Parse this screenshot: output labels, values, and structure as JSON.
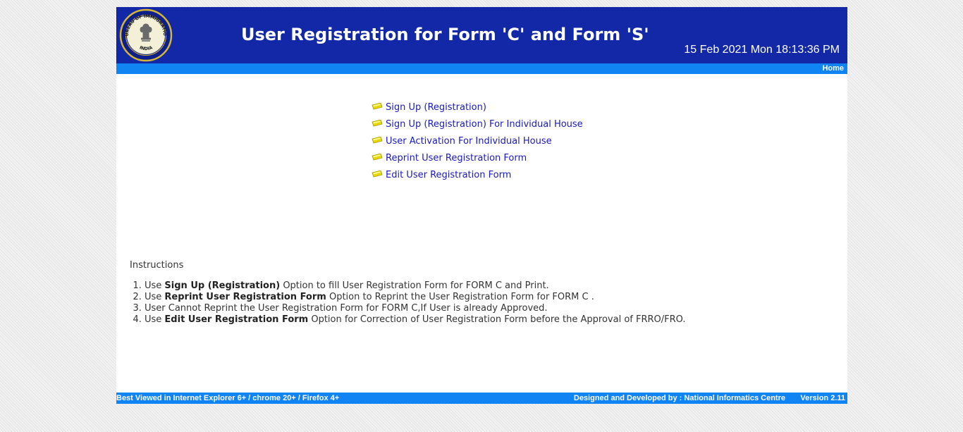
{
  "header": {
    "title": "User Registration for Form 'C' and Form 'S'",
    "datetime": "15 Feb 2021 Mon 18:13:36 PM",
    "emblem": {
      "icon": "bureau-of-immigration-emblem-icon",
      "top_text": "BUREAU OF IMMIGRATION",
      "bottom_text": "INDIA"
    }
  },
  "nav": {
    "home_label": "Home"
  },
  "menu": {
    "bullet_icon": "yellow-bullet-icon",
    "items": [
      {
        "label": "Sign Up (Registration)"
      },
      {
        "label": "Sign Up (Registration) For Individual House"
      },
      {
        "label": "User Activation For Individual House"
      },
      {
        "label": "Reprint User Registration Form"
      },
      {
        "label": "Edit User Registration Form"
      }
    ]
  },
  "instructions": {
    "heading": "Instructions",
    "items": [
      {
        "pre": "Use ",
        "bold": "Sign Up (Registration)",
        "post": " Option to fill User Registration Form for FORM C and Print."
      },
      {
        "pre": "Use ",
        "bold": "Reprint User Registration Form",
        "post": " Option to Reprint the User Registration Form for FORM C ."
      },
      {
        "pre": "User Cannot Reprint the User Registration Form for FORM C,If User is already Approved.",
        "bold": "",
        "post": ""
      },
      {
        "pre": "Use ",
        "bold": "Edit User Registration Form",
        "post": " Option for Correction of User Registration Form before the Approval of FRRO/FRO."
      }
    ]
  },
  "footer": {
    "browsers": "Best Viewed in Internet Explorer 6+ / chrome 20+ / Firefox 4+",
    "credit": "Designed and Developed by : National Informatics Centre",
    "version": "Version 2.11"
  },
  "colors": {
    "header_bg": "#1228a6",
    "bar_bg": "#1184f3",
    "link": "#1a1ab8",
    "bullet": "#e8d800",
    "emblem_ring": "#d4b536"
  }
}
